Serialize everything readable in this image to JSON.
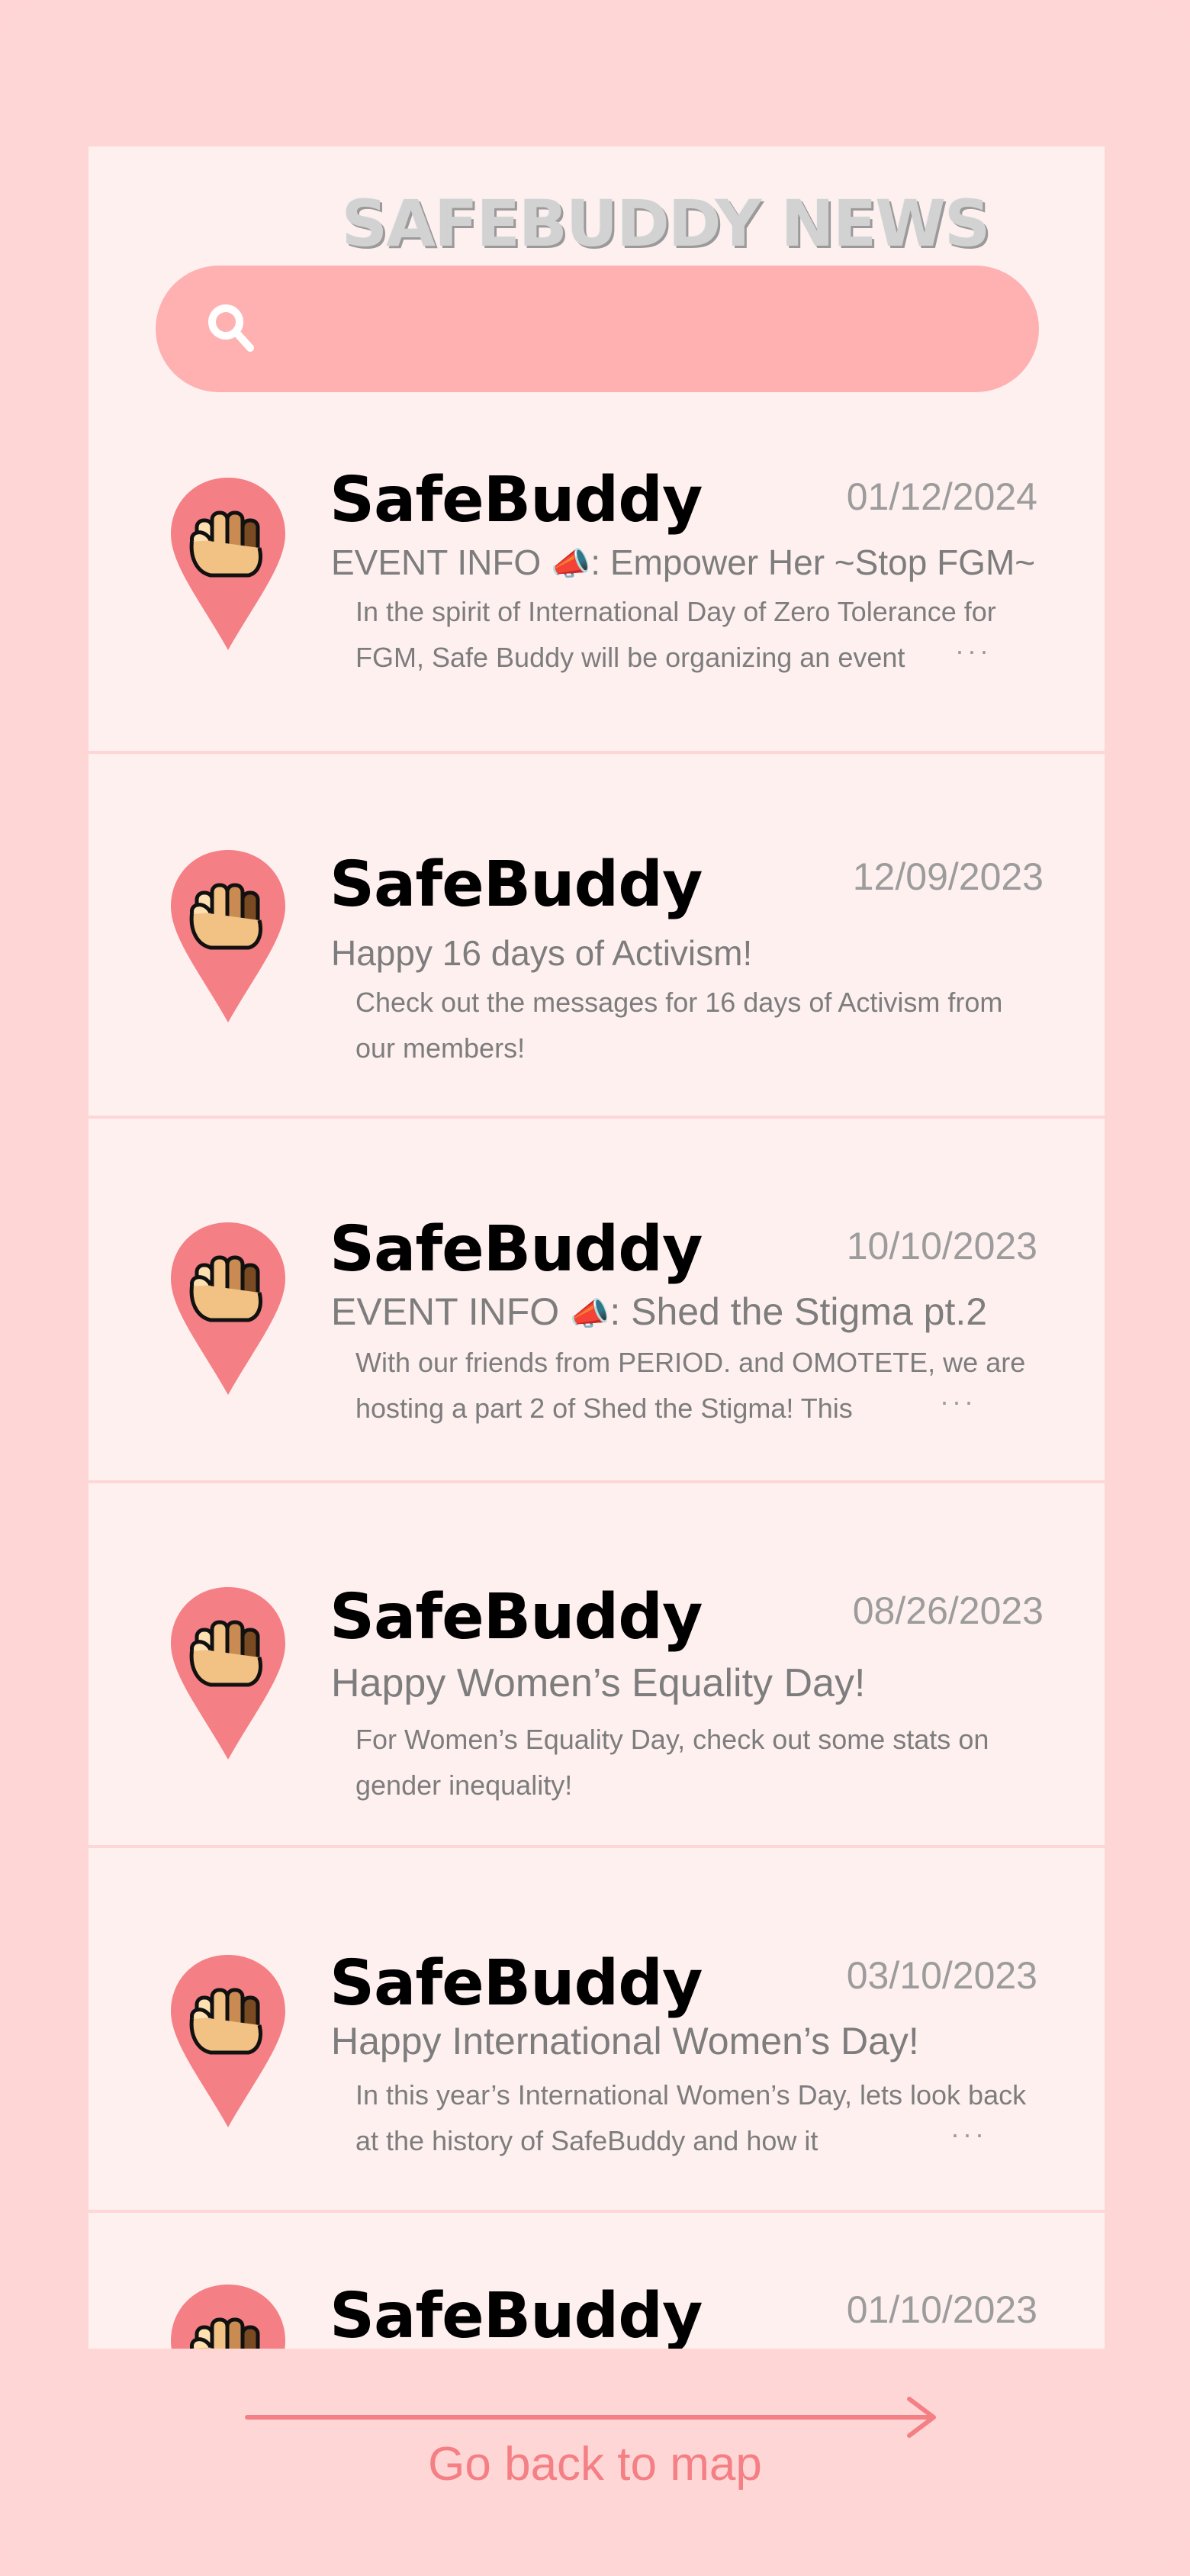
{
  "header": {
    "title": "SAFEBUDDY NEWS"
  },
  "search": {
    "placeholder": "",
    "value": ""
  },
  "colors": {
    "background": "#ffd6d6",
    "panel": "#fff0f0",
    "search_bar": "#ffb1b1",
    "pin": "#f47f84",
    "link": "#f47f84"
  },
  "icons": {
    "search": "search-icon",
    "pin": "fist-location-pin-icon",
    "megaphone": "megaphone-icon",
    "arrow": "arrow-right-icon"
  },
  "news": [
    {
      "title": "SafeBuddy",
      "date": "01/12/2024",
      "headline_pre": "EVENT INFO ",
      "headline_emoji": "📣",
      "headline_post": ": Empower Her ~Stop FGM~",
      "body": "In the spirit of International Day of Zero Tolerance for FGM, Safe Buddy will be organizing an event",
      "more": "···"
    },
    {
      "title": "SafeBuddy",
      "date": "12/09/2023",
      "headline_pre": "Happy 16 days of Activism!",
      "headline_emoji": "",
      "headline_post": "",
      "body": "Check out the messages for 16 days of Activism from our members!",
      "more": ""
    },
    {
      "title": "SafeBuddy",
      "date": "10/10/2023",
      "headline_pre": "EVENT INFO ",
      "headline_emoji": "📣",
      "headline_post": ": Shed the Stigma pt.2",
      "body": "With our friends from PERIOD.  and OMOTETE, we are hosting a part 2 of Shed the Stigma! This",
      "more": "···"
    },
    {
      "title": "SafeBuddy",
      "date": "08/26/2023",
      "headline_pre": "Happy Women’s Equality Day!",
      "headline_emoji": "",
      "headline_post": "",
      "body": "For Women’s Equality Day, check out some stats on gender inequality!",
      "more": ""
    },
    {
      "title": "SafeBuddy",
      "date": "03/10/2023",
      "headline_pre": "Happy International Women’s Day!",
      "headline_emoji": "",
      "headline_post": "",
      "body": "In this year’s International Women’s Day, lets look back at the history of SafeBuddy and how it",
      "more": "···"
    },
    {
      "title": "SafeBuddy",
      "date": "01/10/2023",
      "headline_pre": "",
      "headline_emoji": "",
      "headline_post": "",
      "body": "",
      "more": ""
    }
  ],
  "footer": {
    "back_link": "Go back to map"
  }
}
